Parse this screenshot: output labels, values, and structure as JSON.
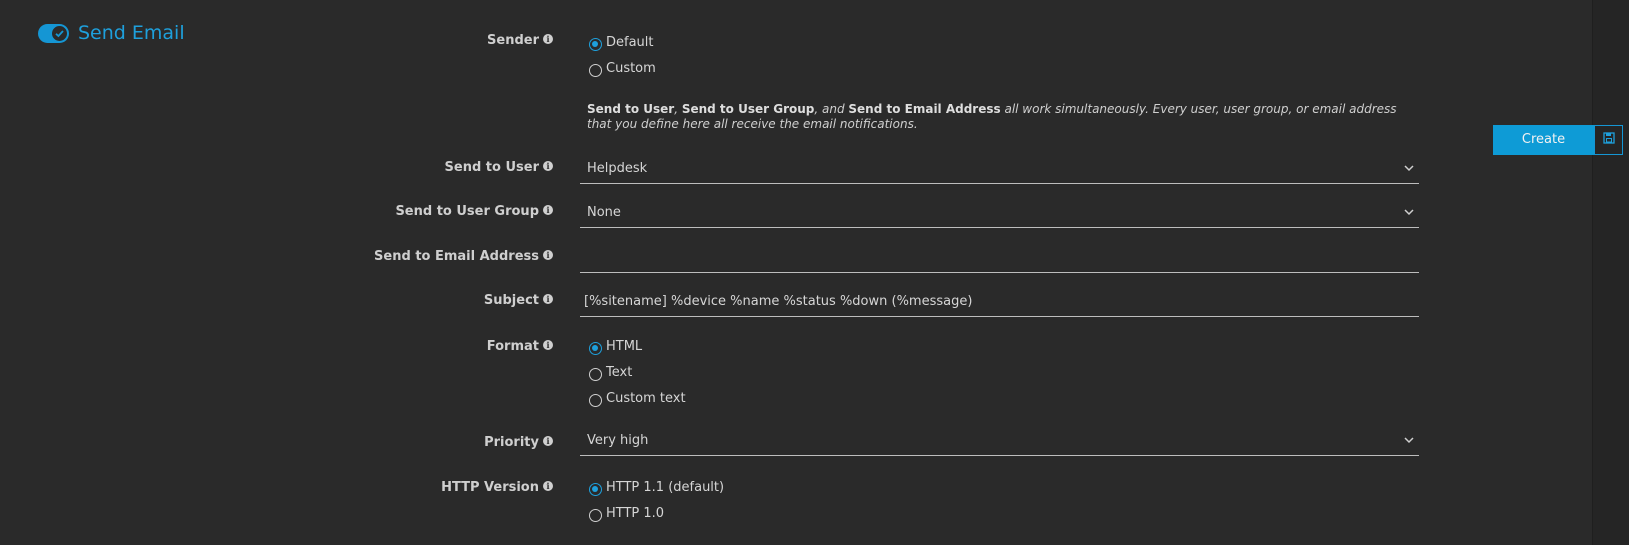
{
  "section": {
    "title": "Send Email",
    "enabled": true
  },
  "sender": {
    "label": "Sender",
    "options": [
      {
        "label": "Default",
        "selected": true
      },
      {
        "label": "Custom",
        "selected": false
      }
    ]
  },
  "note": {
    "b1": "Send to User",
    "t1": ", ",
    "b2": "Send to User Group",
    "t2": ", and ",
    "b3": "Send to Email Address",
    "t3": " all work simultaneously. Every user, user group, or email address that you define here all receive the email notifications."
  },
  "send_to_user": {
    "label": "Send to User",
    "value": "Helpdesk"
  },
  "send_to_user_group": {
    "label": "Send to User Group",
    "value": "None"
  },
  "send_to_email": {
    "label": "Send to Email Address",
    "value": ""
  },
  "subject": {
    "label": "Subject",
    "value": "[%sitename] %device %name %status %down (%message)"
  },
  "format": {
    "label": "Format",
    "options": [
      {
        "label": "HTML",
        "selected": true
      },
      {
        "label": "Text",
        "selected": false
      },
      {
        "label": "Custom text",
        "selected": false
      }
    ]
  },
  "priority": {
    "label": "Priority",
    "value": "Very high"
  },
  "http_version": {
    "label": "HTTP Version",
    "options": [
      {
        "label": "HTTP 1.1 (default)",
        "selected": true
      },
      {
        "label": "HTTP 1.0",
        "selected": false
      }
    ]
  },
  "actions": {
    "create_label": "Create"
  },
  "colors": {
    "accent": "#1596d4",
    "background": "#2a2a2a",
    "text": "#d6d6d6"
  },
  "icons": {
    "toggle": "check-toggle-icon",
    "info": "info-icon",
    "chevron": "chevron-down-icon",
    "save": "floppy-disk-icon"
  }
}
